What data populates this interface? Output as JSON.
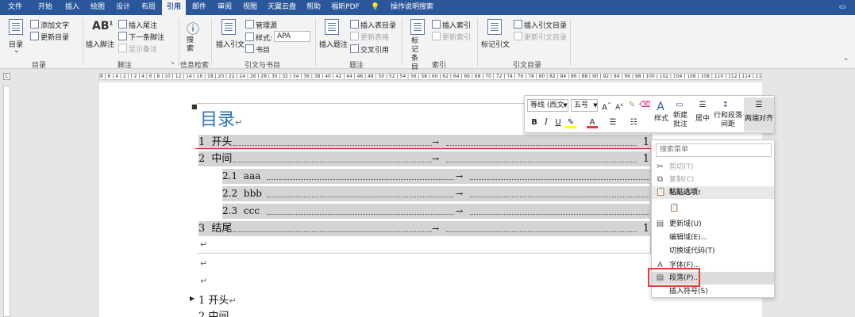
{
  "menubar": {
    "tabs": [
      "文件",
      "开始",
      "插入",
      "绘图",
      "设计",
      "布局",
      "引用",
      "邮件",
      "审阅",
      "视图",
      "天翼云盘",
      "帮助",
      "福昕PDF"
    ],
    "active_tab": "引用",
    "tell_me": "操作说明搜索"
  },
  "ribbon": {
    "toc": {
      "big": "目录",
      "add_text": "添加文字",
      "update_toc": "更新目录",
      "group": "目录"
    },
    "footnotes": {
      "icon_text": "AB",
      "icon_sup": "1",
      "insert_footnote": "插入脚注",
      "insert_endnote": "插入尾注",
      "next_footnote": "下一条脚注",
      "show_notes": "显示备注",
      "group": "脚注"
    },
    "research": {
      "search": "搜索",
      "group": "信息检索"
    },
    "citations": {
      "insert_citation": "插入引文",
      "manage_sources": "管理源",
      "style_label": "样式:",
      "style_value": "APA",
      "bibliography": "书目",
      "group": "引文与书目"
    },
    "captions": {
      "insert_caption": "插入题注",
      "insert_tof": "插入表目录",
      "update_table": "更新表格",
      "cross_ref": "交叉引用",
      "group": "题注"
    },
    "index": {
      "mark_entry": "标记条目",
      "insert_index": "插入索引",
      "update_index": "更新索引",
      "group": "索引"
    },
    "toa": {
      "mark_citation": "标记引文",
      "insert_toa": "插入引文目录",
      "update_toa": "更新引文目录",
      "group": "引文目录"
    }
  },
  "ruler": {
    "text": "8 | 6 | 4 | 2 |   | 2 | 4 | 6 | 8 | 10 | 12 | 14 | 16 | 18 | 20 | 22 | 24 | 26 | 28 | 30 | 32 | 34 | 36 | 38 | 40 | 42 | 44 | 46 | 48 | 50 | 52 | 54 | 56 | 58 | 60 | 62 | 64 | 66 | 68 | 70 | 72 | 74 | 76 | 78 | 80 | 82 | 84 | 86 | 88 | 90 | 92 | 94 | 96 | 98 | 100 | 102 | 104 | 106 | 108 | 110 | 112 | 114 | 116 | 118 | 120 | 122 | 124 | 126 | 128 | 130 | 132 | 134 | 136 | 138 | 140 | 142 | 144 | 146 | 148"
  },
  "document": {
    "toc_title": "目录",
    "para_mark": "↵",
    "tab_arrow": "→",
    "entries": [
      {
        "num": "1",
        "text": "开头",
        "page": "1"
      },
      {
        "num": "2",
        "text": "中间",
        "page": "1"
      },
      {
        "num": "2.1",
        "text": "aaa",
        "page": "1"
      },
      {
        "num": "2.2",
        "text": "bbb",
        "page": "1"
      },
      {
        "num": "2.3",
        "text": "ccc",
        "page": "1"
      },
      {
        "num": "3",
        "text": "结尾",
        "page": "1"
      }
    ],
    "body_heading1": "1 开头",
    "body_heading2": "2 中间"
  },
  "mini_toolbar": {
    "font": "等线 (西文",
    "size": "五号",
    "grow": "A",
    "shrink": "A",
    "bold": "B",
    "italic": "I",
    "underline": "U",
    "font_color": "A",
    "styles": "样式",
    "new_comment": "新建\n批注",
    "center": "居中",
    "line_spacing": "行和段落\n间距",
    "justify": "两端对齐"
  },
  "context_menu": {
    "search_placeholder": "搜索菜单",
    "cut": "剪切(T)",
    "copy": "复制(C)",
    "paste_options": "粘贴选项:",
    "update_field": "更新域(U)",
    "edit_field": "编辑域(E)...",
    "toggle_codes": "切换域代码(T)",
    "font": "字体(F)...",
    "paragraph": "段落(P)...",
    "insert_symbol": "插入符号(S)"
  },
  "colors": {
    "accent": "#2b579a",
    "highlight_border": "#e0403a",
    "title_blue": "#2e74b5"
  }
}
